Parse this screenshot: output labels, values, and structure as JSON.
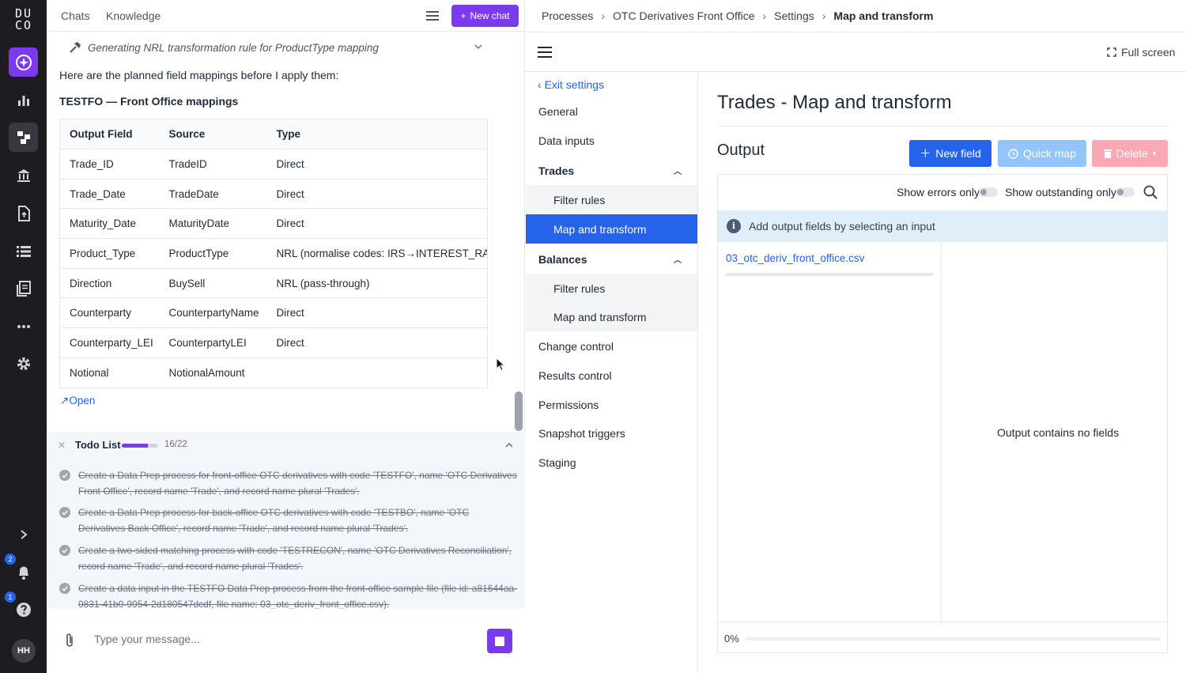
{
  "rail": {
    "logo": "DU CO",
    "badges": {
      "notifications": "2",
      "help": "1"
    },
    "avatar": "HH"
  },
  "chat": {
    "tabs": [
      "Chats",
      "Knowledge"
    ],
    "new_chat": "New chat",
    "generating": "Generating NRL transformation rule for ProductType mapping",
    "intro": "Here are the planned field mappings before I apply them:",
    "heading": "TESTFO — Front Office mappings",
    "table": {
      "headers": [
        "Output Field",
        "Source",
        "Type"
      ],
      "rows": [
        [
          "Trade_ID",
          "TradeID",
          "Direct"
        ],
        [
          "Trade_Date",
          "TradeDate",
          "Direct"
        ],
        [
          "Maturity_Date",
          "MaturityDate",
          "Direct"
        ],
        [
          "Product_Type",
          "ProductType",
          "NRL (normalise codes: IRS→INTEREST_RATE_SWAP"
        ],
        [
          "Direction",
          "BuySell",
          "NRL (pass-through)"
        ],
        [
          "Counterparty",
          "CounterpartyName",
          "Direct"
        ],
        [
          "Counterparty_LEI",
          "CounterpartyLEI",
          "Direct"
        ],
        [
          "Notional",
          "NotionalAmount",
          ""
        ]
      ]
    },
    "open_link": "Open",
    "todo": {
      "title": "Todo List",
      "count": "16/22",
      "progress": 0.727,
      "items": [
        "Create a Data Prep process for front-office OTC derivatives with code 'TESTFO', name 'OTC Derivatives Front Office', record name 'Trade', and record name plural 'Trades'.",
        "Create a Data Prep process for back-office OTC derivatives with code 'TESTBO', name 'OTC Derivatives Back Office', record name 'Trade', and record name plural 'Trades'.",
        "Create a two-sided matching process with code 'TESTRECON', name 'OTC Derivatives Reconciliation', record name 'Trade', and record name plural 'Trades'.",
        "Create a data input in the TESTFO Data Prep process from the front-office sample file (file id: a81644aa-0831-41b0-9954-2d180547dcdf, file name: 03_otc_deriv_front_office.csv)."
      ]
    },
    "composer_placeholder": "Type your message..."
  },
  "app": {
    "breadcrumb": [
      "Processes",
      "OTC Derivatives Front Office",
      "Settings",
      "Map and transform"
    ],
    "fullscreen": "Full screen",
    "nav": {
      "exit": "Exit settings",
      "items": [
        "General",
        "Data inputs"
      ],
      "trades": "Trades",
      "trades_sub": [
        "Filter rules",
        "Map and transform"
      ],
      "balances": "Balances",
      "balances_sub": [
        "Filter rules",
        "Map and transform"
      ],
      "rest": [
        "Change control",
        "Results control",
        "Permissions",
        "Snapshot triggers",
        "Staging"
      ]
    },
    "title": "Trades - Map and transform",
    "output_label": "Output",
    "buttons": {
      "new_field": "New field",
      "quick_map": "Quick map",
      "delete": "Delete"
    },
    "toggles": {
      "errors": "Show errors only",
      "outstanding": "Show outstanding only"
    },
    "info": "Add output fields by selecting an input",
    "input_file": "03_otc_deriv_front_office.csv",
    "empty": "Output contains no fields",
    "progress_pct": "0%"
  },
  "colors": {
    "accent": "#7c3aed",
    "primary": "#2563eb",
    "rail": "#1d1d21"
  }
}
